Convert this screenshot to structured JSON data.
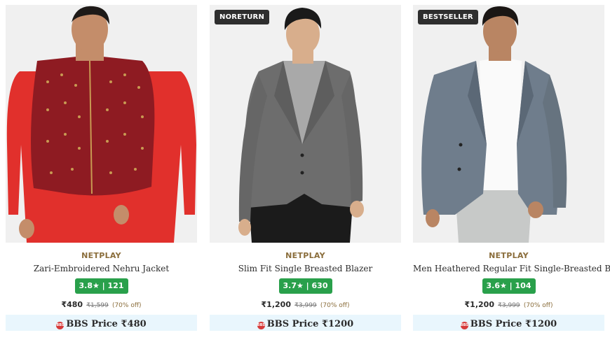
{
  "products": [
    {
      "tag": "",
      "brand": "NETPLAY",
      "name": "Zari-Embroidered Nehru Jacket",
      "rating": "3.8★ | 121",
      "price": "₹480",
      "mrp": "₹1,599",
      "discount": "(70% off)",
      "bbs_label": "BBS Price ₹480"
    },
    {
      "tag": "NORETURN",
      "brand": "NETPLAY",
      "name": "Slim Fit Single Breasted Blazer",
      "rating": "3.7★ | 630",
      "price": "₹1,200",
      "mrp": "₹3,999",
      "discount": "(70% off)",
      "bbs_label": "BBS Price ₹1200"
    },
    {
      "tag": "BESTSELLER",
      "brand": "NETPLAY",
      "name": "Men Heathered Regular Fit Single-Breasted Blazer",
      "rating": "3.6★ | 104",
      "price": "₹1,200",
      "mrp": "₹3,999",
      "discount": "(70% off)",
      "bbs_label": "BBS Price ₹1200"
    }
  ],
  "colors": {
    "rating_bg": "#29a04b",
    "brand_text": "#8a6d3b",
    "bbs_bg": "#e9f6fd",
    "tag_bg": "#2e2e2e"
  },
  "icons": {
    "bbs_badge": "bbs-logo-icon"
  }
}
